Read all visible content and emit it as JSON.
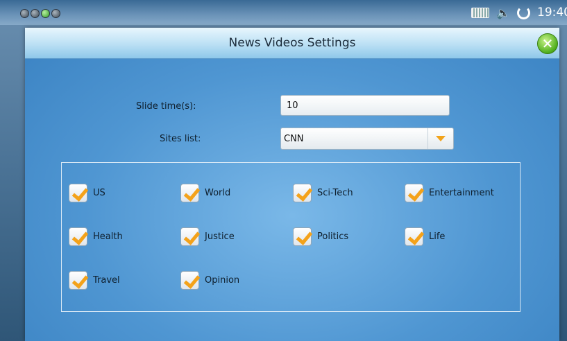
{
  "statusbar": {
    "clock": "19:40",
    "icons": [
      "keyboard-icon",
      "speaker-icon",
      "sync-icon"
    ]
  },
  "dialog": {
    "title": "News Videos Settings",
    "slide_time_label": "Slide time(s):",
    "slide_time_value": "10",
    "sites_list_label": "Sites list:",
    "sites_list_value": "CNN",
    "categories": [
      {
        "label": "US",
        "checked": true
      },
      {
        "label": "World",
        "checked": true
      },
      {
        "label": "Sci-Tech",
        "checked": true
      },
      {
        "label": "Entertainment",
        "checked": true
      },
      {
        "label": "Health",
        "checked": true
      },
      {
        "label": "Justice",
        "checked": true
      },
      {
        "label": "Politics",
        "checked": true
      },
      {
        "label": "Life",
        "checked": true
      },
      {
        "label": "Travel",
        "checked": true
      },
      {
        "label": "Opinion",
        "checked": true
      }
    ]
  },
  "colors": {
    "dialog_bg": "#4f96d2",
    "titlebar": "#bfe2f5",
    "check_accent": "#f4a21a",
    "close_button": "#4fae1c"
  }
}
